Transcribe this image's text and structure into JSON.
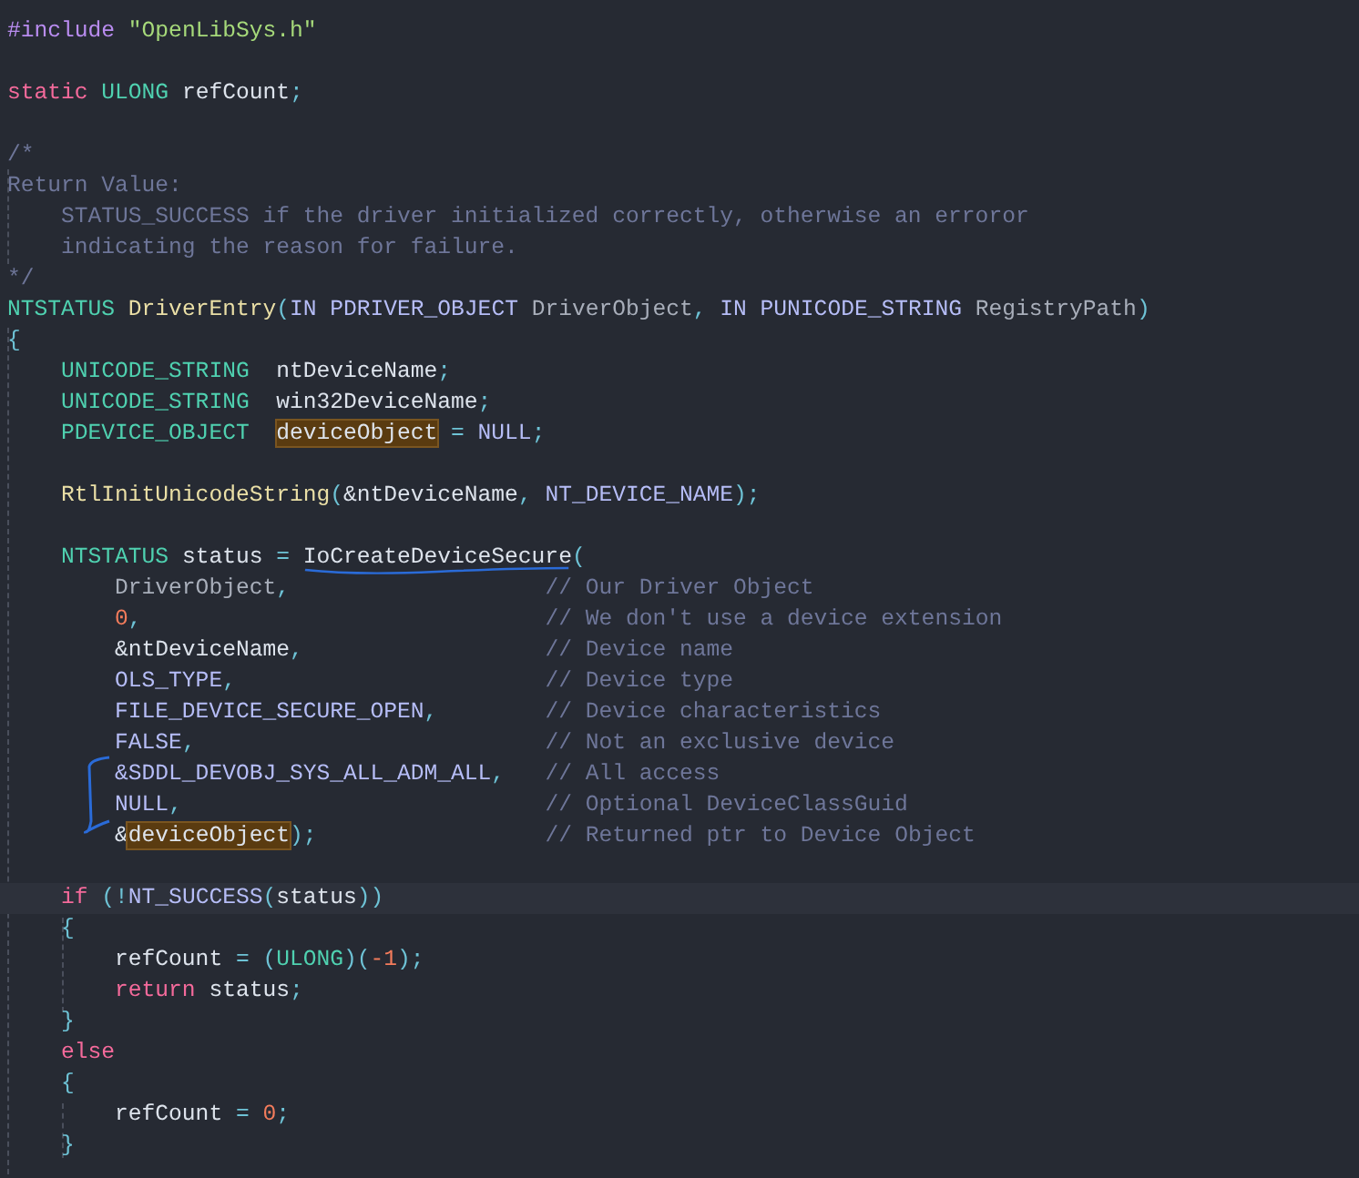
{
  "editor": {
    "lines": [
      {
        "kind": "code",
        "tokens": [
          {
            "text": "#include ",
            "kind": "directive"
          },
          {
            "text": "\"OpenLibSys.h\"",
            "kind": "string"
          }
        ]
      },
      {
        "kind": "blank"
      },
      {
        "kind": "code",
        "tokens": [
          {
            "text": "static ",
            "kind": "keyword"
          },
          {
            "text": "ULONG ",
            "kind": "type"
          },
          {
            "text": "refCount",
            "kind": "var"
          },
          {
            "text": ";",
            "kind": "punct"
          }
        ]
      },
      {
        "kind": "blank"
      },
      {
        "kind": "code",
        "tokens": [
          {
            "text": "/*",
            "kind": "comment"
          }
        ]
      },
      {
        "kind": "code",
        "tokens": [
          {
            "text": "Return Value:",
            "kind": "comment"
          }
        ]
      },
      {
        "kind": "code",
        "tokens": [
          {
            "text": "    STATUS_SUCCESS if the driver initialized correctly, otherwise an erroror",
            "kind": "comment"
          }
        ]
      },
      {
        "kind": "code",
        "tokens": [
          {
            "text": "    indicating the reason for failure.",
            "kind": "comment"
          }
        ]
      },
      {
        "kind": "code",
        "tokens": [
          {
            "text": "*/",
            "kind": "comment"
          }
        ]
      },
      {
        "kind": "code",
        "tokens": [
          {
            "text": "NTSTATUS ",
            "kind": "type"
          },
          {
            "text": "DriverEntry",
            "kind": "func"
          },
          {
            "text": "(",
            "kind": "punct"
          },
          {
            "text": "IN PDRIVER_OBJECT ",
            "kind": "macro"
          },
          {
            "text": "DriverObject",
            "kind": "param"
          },
          {
            "text": ", ",
            "kind": "punct"
          },
          {
            "text": "IN PUNICODE_STRING ",
            "kind": "macro"
          },
          {
            "text": "RegistryPath",
            "kind": "param"
          },
          {
            "text": ")",
            "kind": "punct"
          }
        ]
      },
      {
        "kind": "code",
        "tokens": [
          {
            "text": "{",
            "kind": "punct"
          }
        ]
      },
      {
        "kind": "code",
        "tokens": [
          {
            "text": "    UNICODE_STRING  ",
            "kind": "type"
          },
          {
            "text": "ntDeviceName",
            "kind": "var"
          },
          {
            "text": ";",
            "kind": "punct"
          }
        ]
      },
      {
        "kind": "code",
        "tokens": [
          {
            "text": "    UNICODE_STRING  ",
            "kind": "type"
          },
          {
            "text": "win32DeviceName",
            "kind": "var"
          },
          {
            "text": ";",
            "kind": "punct"
          }
        ]
      },
      {
        "kind": "code",
        "tokens": [
          {
            "text": "    PDEVICE_OBJECT  ",
            "kind": "type"
          },
          {
            "text": "deviceObject",
            "kind": "var",
            "highlighted": true
          },
          {
            "text": " = ",
            "kind": "punct"
          },
          {
            "text": "NULL",
            "kind": "macro"
          },
          {
            "text": ";",
            "kind": "punct"
          }
        ]
      },
      {
        "kind": "blank"
      },
      {
        "kind": "code",
        "tokens": [
          {
            "text": "    RtlInitUnicodeString",
            "kind": "func"
          },
          {
            "text": "(",
            "kind": "punct"
          },
          {
            "text": "&ntDeviceName",
            "kind": "var"
          },
          {
            "text": ", ",
            "kind": "punct"
          },
          {
            "text": "NT_DEVICE_NAME",
            "kind": "macro"
          },
          {
            "text": ");",
            "kind": "punct"
          }
        ]
      },
      {
        "kind": "blank"
      },
      {
        "kind": "code",
        "tokens": [
          {
            "text": "    NTSTATUS ",
            "kind": "type"
          },
          {
            "text": "status",
            "kind": "var"
          },
          {
            "text": " = ",
            "kind": "punct"
          },
          {
            "text": "IoCreateDeviceSecure",
            "kind": "var",
            "underlined": true
          },
          {
            "text": "(",
            "kind": "punct"
          }
        ]
      },
      {
        "kind": "code",
        "tokens": [
          {
            "text": "        DriverObject",
            "kind": "param"
          },
          {
            "text": ",                   ",
            "kind": "punct"
          },
          {
            "text": "// Our Driver Object",
            "kind": "comment"
          }
        ]
      },
      {
        "kind": "code",
        "tokens": [
          {
            "text": "        0",
            "kind": "number"
          },
          {
            "text": ",                              ",
            "kind": "punct"
          },
          {
            "text": "// We don't use a device extension",
            "kind": "comment"
          }
        ]
      },
      {
        "kind": "code",
        "tokens": [
          {
            "text": "        &ntDeviceName",
            "kind": "var"
          },
          {
            "text": ",                  ",
            "kind": "punct"
          },
          {
            "text": "// Device name",
            "kind": "comment"
          }
        ]
      },
      {
        "kind": "code",
        "tokens": [
          {
            "text": "        OLS_TYPE",
            "kind": "macro"
          },
          {
            "text": ",                       ",
            "kind": "punct"
          },
          {
            "text": "// Device type",
            "kind": "comment"
          }
        ]
      },
      {
        "kind": "code",
        "tokens": [
          {
            "text": "        FILE_DEVICE_SECURE_OPEN",
            "kind": "macro"
          },
          {
            "text": ",        ",
            "kind": "punct"
          },
          {
            "text": "// Device characteristics",
            "kind": "comment"
          }
        ]
      },
      {
        "kind": "code",
        "tokens": [
          {
            "text": "        FALSE",
            "kind": "macro"
          },
          {
            "text": ",                          ",
            "kind": "punct"
          },
          {
            "text": "// Not an exclusive device",
            "kind": "comment"
          }
        ]
      },
      {
        "kind": "code",
        "tokens": [
          {
            "text": "        &SDDL_DEVOBJ_SYS_ALL_ADM_ALL",
            "kind": "macro"
          },
          {
            "text": ",   ",
            "kind": "punct"
          },
          {
            "text": "// All access",
            "kind": "comment"
          }
        ]
      },
      {
        "kind": "code",
        "tokens": [
          {
            "text": "        NULL",
            "kind": "macro"
          },
          {
            "text": ",                           ",
            "kind": "punct"
          },
          {
            "text": "// Optional DeviceClassGuid",
            "kind": "comment"
          }
        ]
      },
      {
        "kind": "code",
        "tokens": [
          {
            "text": "        &",
            "kind": "var"
          },
          {
            "text": "deviceObject",
            "kind": "var",
            "highlighted": true
          },
          {
            "text": ");                 ",
            "kind": "punct"
          },
          {
            "text": "// Returned ptr to Device Object",
            "kind": "comment"
          }
        ]
      },
      {
        "kind": "blank"
      },
      {
        "kind": "code",
        "current": true,
        "tokens": [
          {
            "text": "    if ",
            "kind": "keyword"
          },
          {
            "text": "(!",
            "kind": "punct"
          },
          {
            "text": "NT_SUCCESS",
            "kind": "macro"
          },
          {
            "text": "(",
            "kind": "punct"
          },
          {
            "text": "status",
            "kind": "var"
          },
          {
            "text": "))",
            "kind": "punct"
          }
        ]
      },
      {
        "kind": "code",
        "tokens": [
          {
            "text": "    {",
            "kind": "punct"
          }
        ]
      },
      {
        "kind": "code",
        "tokens": [
          {
            "text": "        refCount",
            "kind": "var"
          },
          {
            "text": " = (",
            "kind": "punct"
          },
          {
            "text": "ULONG",
            "kind": "type"
          },
          {
            "text": ")(",
            "kind": "punct"
          },
          {
            "text": "-1",
            "kind": "number"
          },
          {
            "text": ");",
            "kind": "punct"
          }
        ]
      },
      {
        "kind": "code",
        "tokens": [
          {
            "text": "        return ",
            "kind": "keyword"
          },
          {
            "text": "status",
            "kind": "var"
          },
          {
            "text": ";",
            "kind": "punct"
          }
        ]
      },
      {
        "kind": "code",
        "tokens": [
          {
            "text": "    }",
            "kind": "punct"
          }
        ]
      },
      {
        "kind": "code",
        "tokens": [
          {
            "text": "    else",
            "kind": "keyword"
          }
        ]
      },
      {
        "kind": "code",
        "tokens": [
          {
            "text": "    {",
            "kind": "punct"
          }
        ]
      },
      {
        "kind": "code",
        "tokens": [
          {
            "text": "        refCount",
            "kind": "var"
          },
          {
            "text": " = ",
            "kind": "punct"
          },
          {
            "text": "0",
            "kind": "number"
          },
          {
            "text": ";",
            "kind": "punct"
          }
        ]
      },
      {
        "kind": "code",
        "tokens": [
          {
            "text": "    }",
            "kind": "punct"
          }
        ]
      }
    ]
  }
}
